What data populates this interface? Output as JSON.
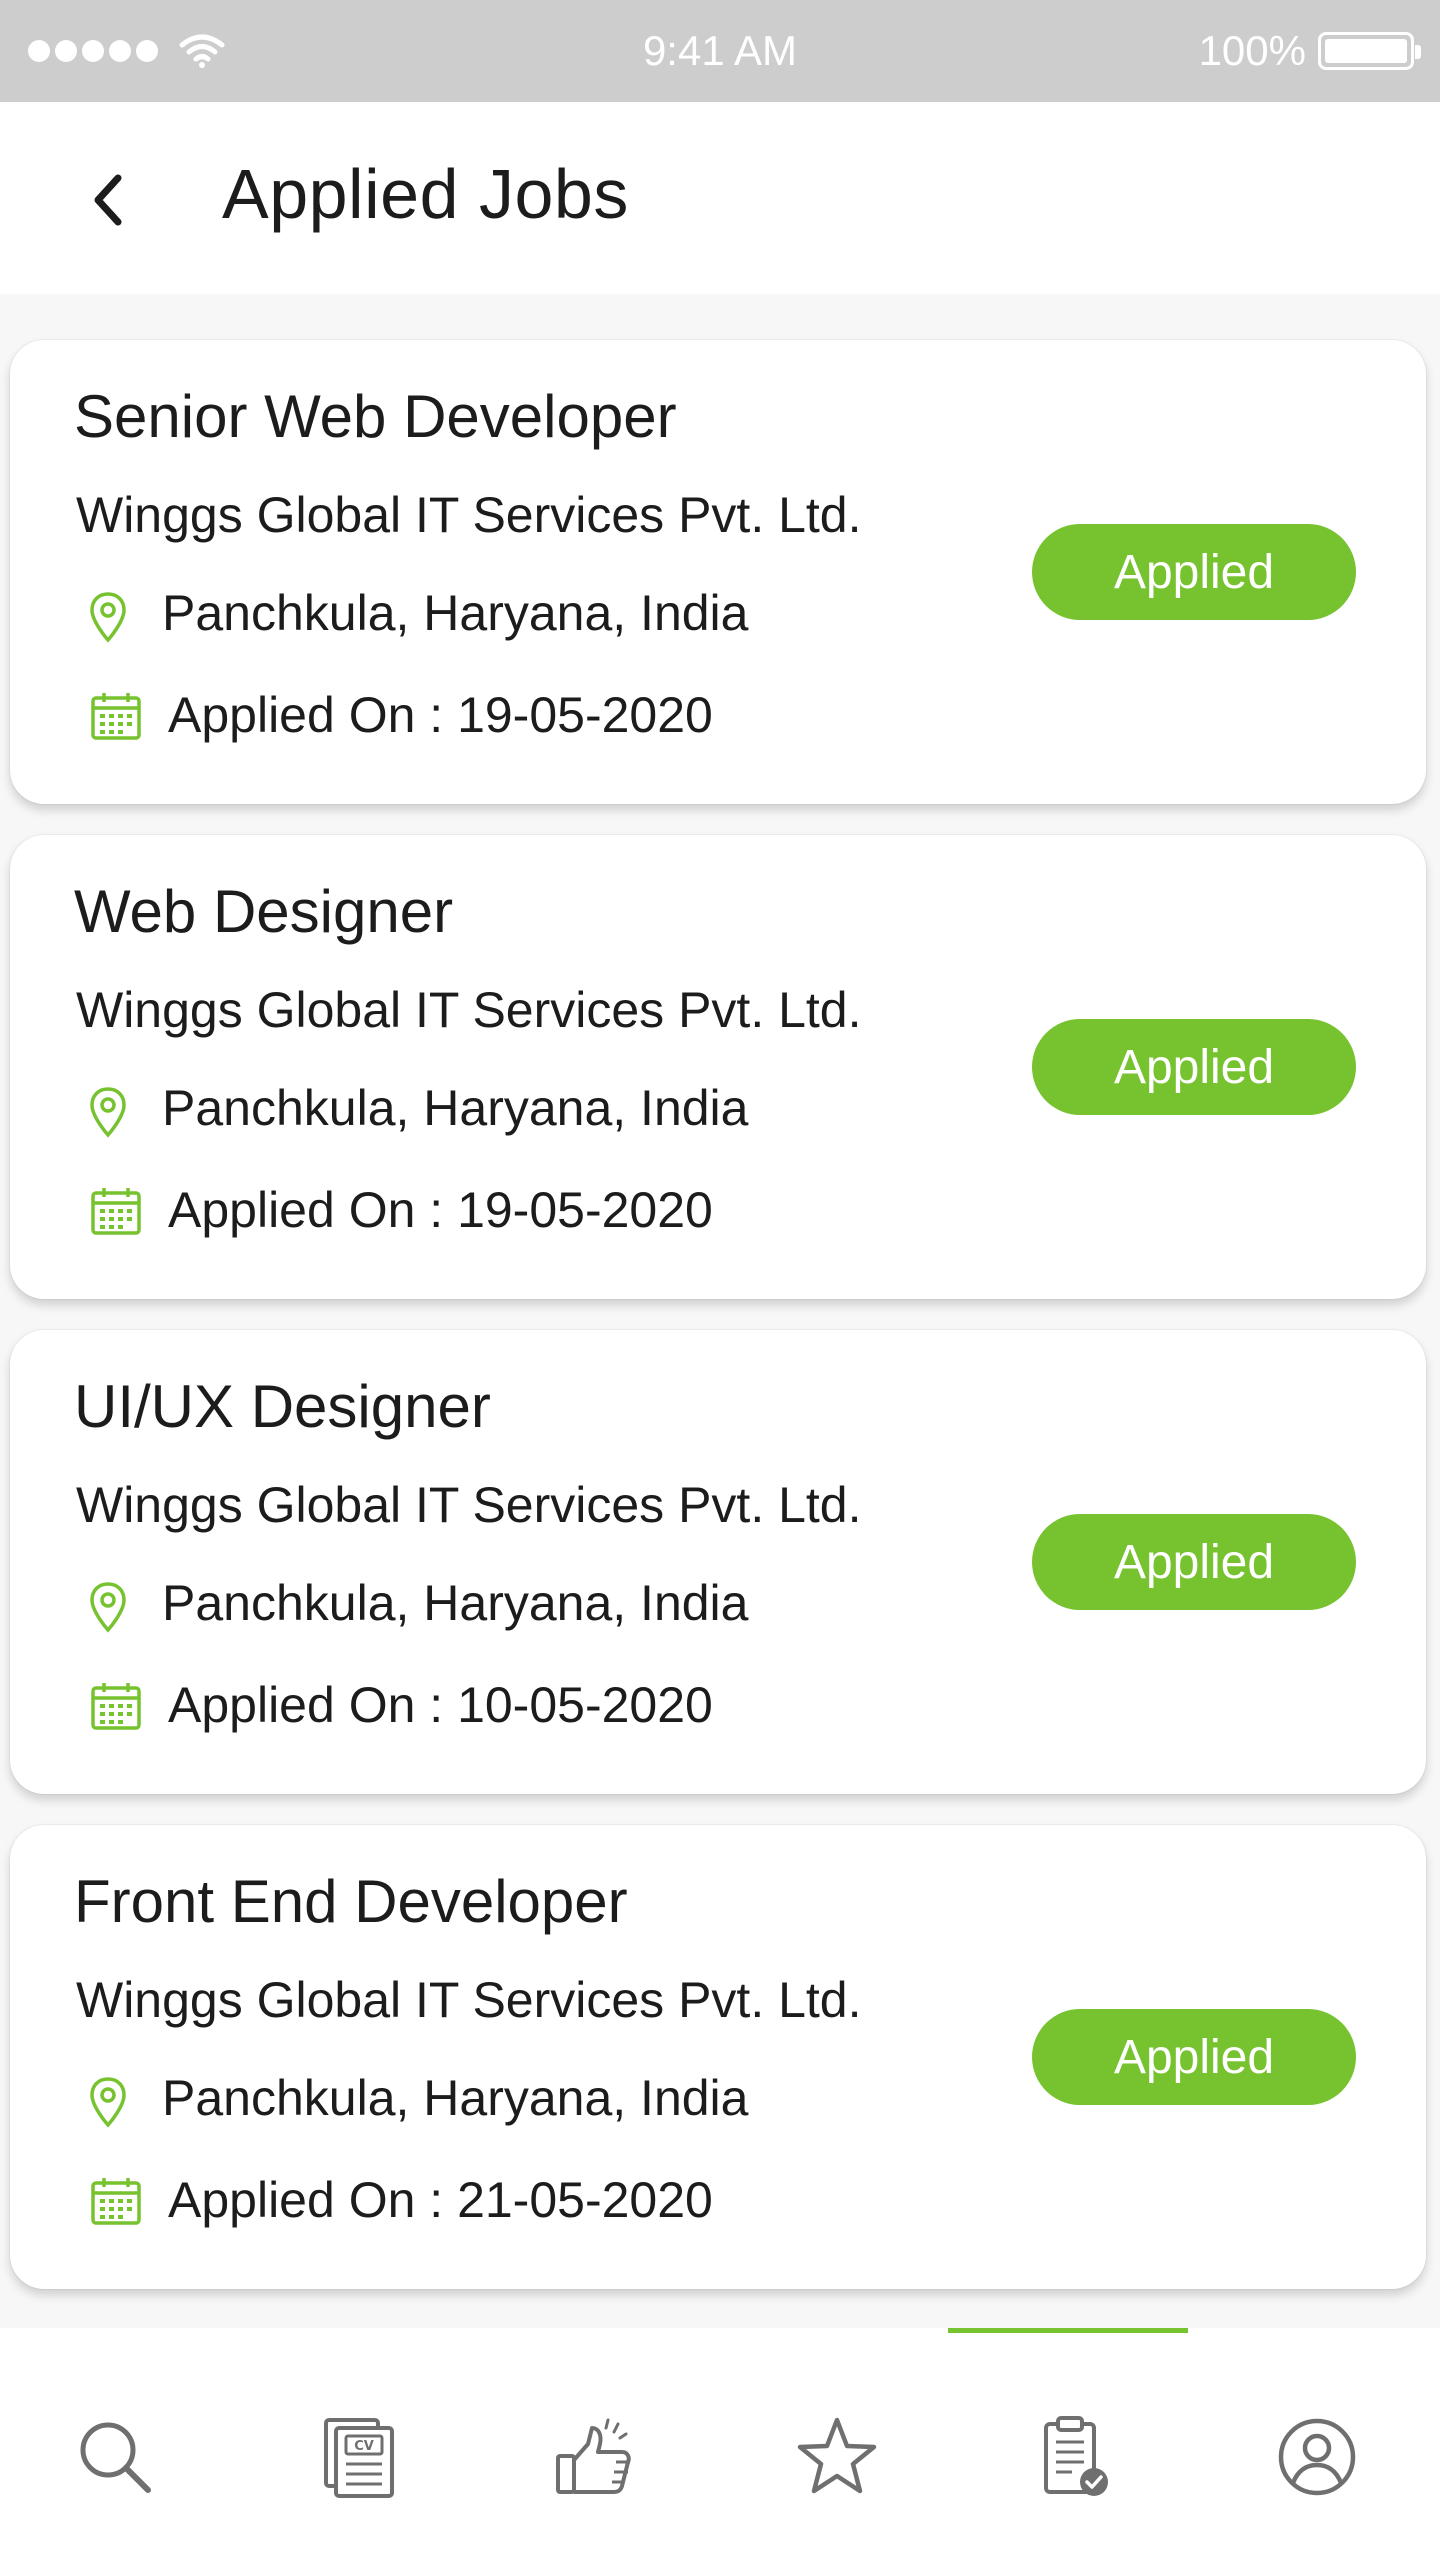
{
  "status_bar": {
    "time": "9:41 AM",
    "battery": "100%"
  },
  "header": {
    "title": "Applied Jobs"
  },
  "jobs": [
    {
      "title": "Senior Web Developer",
      "company": "Winggs Global IT Services Pvt. Ltd.",
      "location": "Panchkula, Haryana, India",
      "applied_on": "Applied On : 19-05-2020",
      "status": "Applied"
    },
    {
      "title": "Web Designer",
      "company": "Winggs Global IT Services Pvt. Ltd.",
      "location": "Panchkula, Haryana, India",
      "applied_on": "Applied On : 19-05-2020",
      "status": "Applied"
    },
    {
      "title": "UI/UX Designer",
      "company": "Winggs Global IT Services Pvt. Ltd.",
      "location": "Panchkula, Haryana, India",
      "applied_on": "Applied On : 10-05-2020",
      "status": "Applied"
    },
    {
      "title": "Front End Developer",
      "company": "Winggs Global IT Services Pvt. Ltd.",
      "location": "Panchkula, Haryana, India",
      "applied_on": "Applied On : 21-05-2020",
      "status": "Applied"
    }
  ],
  "bottom_nav": {
    "items": [
      "search-icon",
      "cv-icon",
      "thumbs-up-icon",
      "star-icon",
      "applied-clipboard-icon",
      "profile-icon"
    ],
    "active": "applied-clipboard-icon"
  },
  "colors": {
    "accent": "#76c22f",
    "status_bar": "#cdcdcd",
    "icon_gray": "#6f6f6f"
  }
}
